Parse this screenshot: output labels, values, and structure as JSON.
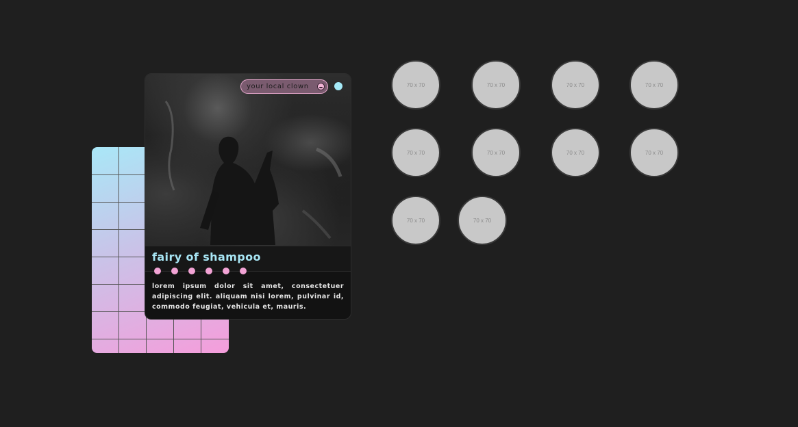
{
  "card": {
    "tag_label": "your local clown",
    "tag_icon": "clown-face-icon",
    "title": "fairy of shampoo",
    "description": "lorem ipsum dolor sit amet, consectetuer adipiscing elit. aliquam nisi lorem, pulvinar id, commodo feugiat, vehicula et, mauris.",
    "dot_count": 6
  },
  "colors": {
    "accent_blue": "#a8e6f5",
    "accent_pink": "#f2a3d5",
    "background": "#1f1f1f"
  },
  "thumbnails": [
    {
      "label": "70 x 70"
    },
    {
      "label": "70 x 70"
    },
    {
      "label": "70 x 70"
    },
    {
      "label": "70 x 70"
    },
    {
      "label": "70 x 70"
    },
    {
      "label": "70 x 70"
    },
    {
      "label": "70 x 70"
    },
    {
      "label": "70 x 70"
    },
    {
      "label": "70 x 70"
    },
    {
      "label": "70 x 70"
    }
  ]
}
